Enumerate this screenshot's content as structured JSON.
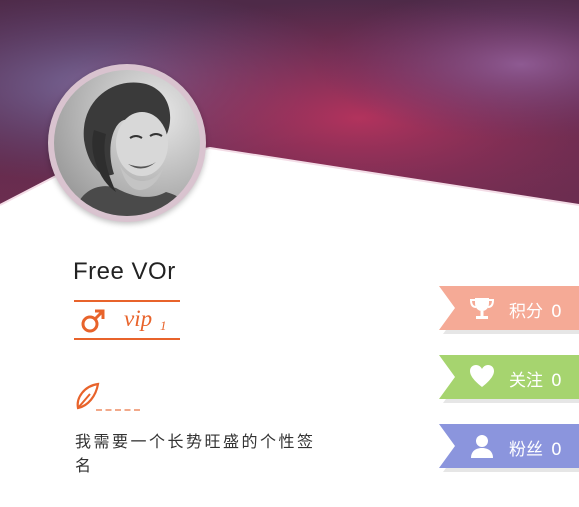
{
  "profile": {
    "name": "Free VOr",
    "vip_label": "vip",
    "vip_level": "1",
    "signature": "我需要一个长势旺盛的个性签名"
  },
  "icons": {
    "gender": "male-symbol-icon",
    "signature": "quill-icon",
    "points": "trophy-icon",
    "follow": "heart-icon",
    "fans": "person-icon"
  },
  "stats": [
    {
      "label": "积分",
      "value": "0",
      "color": "#f5aa96"
    },
    {
      "label": "关注",
      "value": "0",
      "color": "#a6d46f"
    },
    {
      "label": "粉丝",
      "value": "0",
      "color": "#8b95dd"
    }
  ],
  "colors": {
    "accent": "#e8632b",
    "banner_primary": "#8a2f5a",
    "banner_secondary": "#5d4a7d"
  }
}
